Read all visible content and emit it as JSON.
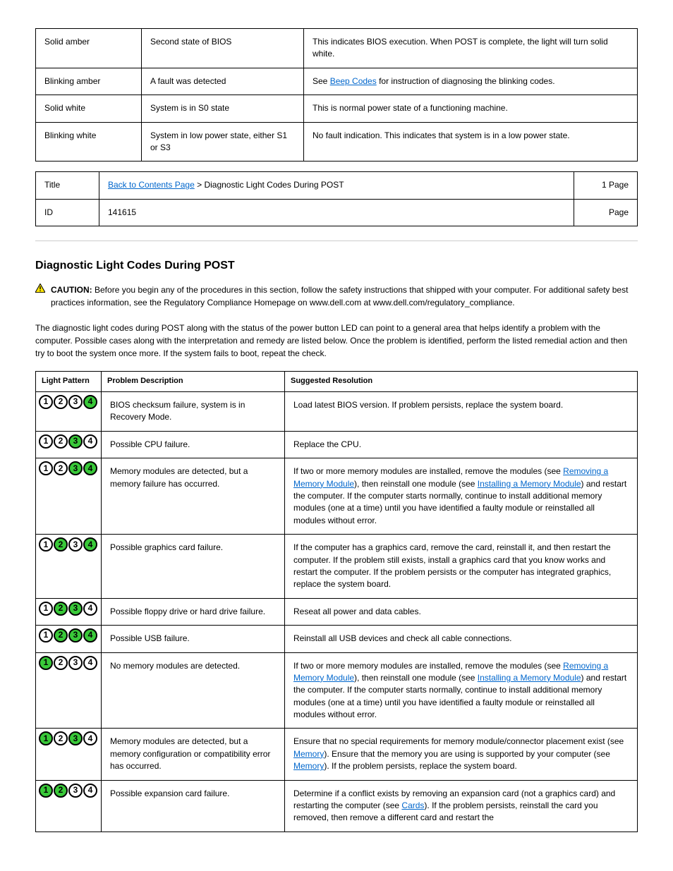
{
  "topTable": {
    "rows": [
      {
        "c0": "Solid amber",
        "c1": "Second state of BIOS",
        "c2": "This indicates BIOS execution. When POST is complete, the light will turn solid white."
      },
      {
        "c0": "Blinking amber",
        "c1": "A fault was detected",
        "c2_pre": "See ",
        "c2_link": "Beep Codes",
        "c2_post": " for instruction of diagnosing the blinking codes."
      },
      {
        "c0": "Solid white",
        "c1": "System is in S0 state",
        "c2": "This is normal power state of a functioning machine."
      },
      {
        "c0": "Blinking white",
        "c1": "System in low power state, either S1 or S3",
        "c2": "No fault indication. This indicates that system is in a low power state."
      }
    ]
  },
  "navTable": {
    "prevLink": "Back to Contents Page",
    "title": "Diagnostic Light Codes During POST",
    "title_label": "Title",
    "page": "1 Page",
    "page_label": "Page",
    "id_label": "ID",
    "id_value": "141615"
  },
  "section": {
    "heading": "Diagnostic Light Codes During POST",
    "caution_label": "CAUTION:",
    "caution_text": " Before you begin any of the procedures in this section, follow the safety instructions that shipped with your computer. For additional safety best practices information, see the Regulatory Compliance Homepage on www.dell.com at www.dell.com/regulatory_compliance.",
    "intro": "The diagnostic light codes during POST along with the status of the power button LED can point to a general area that helps identify a problem with the computer. Possible cases along with the interpretation and remedy are listed below. Once the problem is identified, perform the listed remedial action and then try to boot the system once more. If the system fails to boot, repeat the check."
  },
  "ledTable": {
    "headers": {
      "c0": "Light Pattern",
      "c1": "Problem Description",
      "c2": "Suggested Resolution"
    },
    "rows": [
      {
        "pattern": [
          0,
          0,
          0,
          1
        ],
        "desc": "BIOS checksum failure, system is in Recovery Mode.",
        "res": [
          {
            "t": "text",
            "v": "Load latest BIOS version. If problem persists, replace the system board."
          }
        ]
      },
      {
        "pattern": [
          0,
          0,
          1,
          0
        ],
        "desc": "Possible CPU failure.",
        "res": [
          {
            "t": "text",
            "v": "Replace the CPU."
          }
        ]
      },
      {
        "pattern": [
          0,
          0,
          1,
          1
        ],
        "desc": "Memory modules are detected, but a memory failure has occurred.",
        "res": [
          {
            "t": "text",
            "v": "If two or more memory modules are installed, remove the modules (see "
          },
          {
            "t": "link",
            "v": "Removing a Memory Module"
          },
          {
            "t": "text",
            "v": "), then reinstall one module (see "
          },
          {
            "t": "link",
            "v": "Installing a Memory Module"
          },
          {
            "t": "text",
            "v": ") and restart the computer. If the computer starts normally, continue to install additional memory modules (one at a time) until you have identified a faulty module or reinstalled all modules without error."
          }
        ]
      },
      {
        "pattern": [
          0,
          1,
          0,
          1
        ],
        "desc": "Possible graphics card failure.",
        "res": [
          {
            "t": "text",
            "v": "If the computer has a graphics card, remove the card, reinstall it, and then restart the computer. If the problem still exists, install a graphics card that you know works and restart the computer. If the problem persists or the computer has integrated graphics, replace the system board."
          }
        ]
      },
      {
        "pattern": [
          0,
          1,
          1,
          0
        ],
        "desc": "Possible floppy drive or hard drive failure.",
        "res": [
          {
            "t": "text",
            "v": "Reseat all power and data cables."
          }
        ]
      },
      {
        "pattern": [
          0,
          1,
          1,
          1
        ],
        "desc": "Possible USB failure.",
        "res": [
          {
            "t": "text",
            "v": "Reinstall all USB devices and check all cable connections."
          }
        ]
      },
      {
        "pattern": [
          1,
          0,
          0,
          0
        ],
        "desc": "No memory modules are detected.",
        "res": [
          {
            "t": "text",
            "v": "If two or more memory modules are installed, remove the modules (see "
          },
          {
            "t": "link",
            "v": "Removing a Memory Module"
          },
          {
            "t": "text",
            "v": "), then reinstall one module (see "
          },
          {
            "t": "link",
            "v": "Installing a Memory Module"
          },
          {
            "t": "text",
            "v": ") and restart the computer. If the computer starts normally, continue to install additional memory modules (one at a time) until you have identified a faulty module or reinstalled all modules without error."
          }
        ]
      },
      {
        "pattern": [
          1,
          0,
          1,
          0
        ],
        "desc": "Memory modules are detected, but a memory configuration or compatibility error has occurred.",
        "res": [
          {
            "t": "text",
            "v": "Ensure that no special requirements for memory module/connector placement exist (see "
          },
          {
            "t": "link",
            "v": "Memory"
          },
          {
            "t": "text",
            "v": "). Ensure that the memory you are using is supported by your computer (see "
          },
          {
            "t": "link",
            "v": "Memory"
          },
          {
            "t": "text",
            "v": "). If the problem persists, replace the system board."
          }
        ]
      },
      {
        "pattern": [
          1,
          1,
          0,
          0
        ],
        "desc": "Possible expansion card failure.",
        "res": [
          {
            "t": "text",
            "v": "Determine if a conflict exists by removing an expansion card (not a graphics card) and restarting the computer (see "
          },
          {
            "t": "link",
            "v": "Cards"
          },
          {
            "t": "text",
            "v": "). If the problem persists, reinstall the card you removed, then remove a different card and restart the"
          }
        ]
      }
    ]
  }
}
